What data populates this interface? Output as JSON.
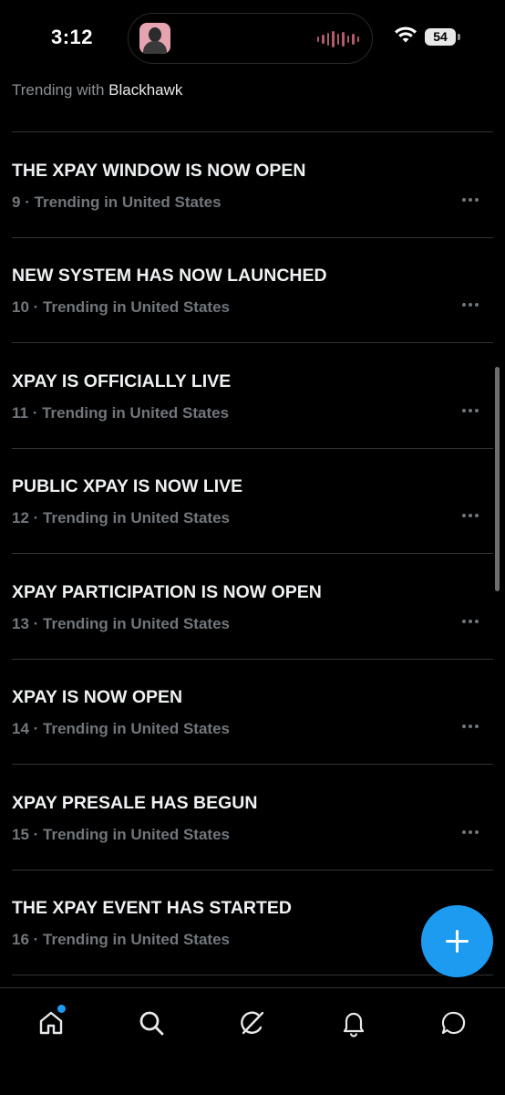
{
  "status_bar": {
    "time": "3:12",
    "battery": "54",
    "icons": [
      "now-playing-avatar",
      "audio-waveform-icon",
      "wifi-icon",
      "battery-icon"
    ]
  },
  "partial_row": {
    "prefix": "Trending with",
    "account": "Blackhawk"
  },
  "trends": [
    {
      "title": "THE XPAY WINDOW IS NOW OPEN",
      "rank": "9",
      "location": "Trending in United States"
    },
    {
      "title": "NEW SYSTEM HAS NOW LAUNCHED",
      "rank": "10",
      "location": "Trending in United States"
    },
    {
      "title": "XPAY IS OFFICIALLY LIVE",
      "rank": "11",
      "location": "Trending in United States"
    },
    {
      "title": "PUBLIC XPAY IS NOW LIVE",
      "rank": "12",
      "location": "Trending in United States"
    },
    {
      "title": "XPAY PARTICIPATION IS NOW OPEN",
      "rank": "13",
      "location": "Trending in United States"
    },
    {
      "title": "XPAY IS NOW OPEN",
      "rank": "14",
      "location": "Trending in United States"
    },
    {
      "title": "XPAY PRESALE HAS BEGUN",
      "rank": "15",
      "location": "Trending in United States"
    },
    {
      "title": "THE XPAY EVENT HAS STARTED",
      "rank": "16",
      "location": "Trending in United States"
    }
  ],
  "fab": {
    "icon": "plus-icon"
  },
  "bottom_nav": [
    {
      "name": "home",
      "icon": "home-icon",
      "has_badge": true
    },
    {
      "name": "search",
      "icon": "search-icon",
      "has_badge": false
    },
    {
      "name": "grok",
      "icon": "grok-icon",
      "has_badge": false
    },
    {
      "name": "notifications",
      "icon": "bell-icon",
      "has_badge": false
    },
    {
      "name": "messages",
      "icon": "messages-icon",
      "has_badge": false
    }
  ],
  "colors": {
    "background": "#000000",
    "accent": "#1d9bf0",
    "text_primary": "#e7e9ea",
    "text_secondary": "#71767b",
    "divider": "#2f3336"
  }
}
